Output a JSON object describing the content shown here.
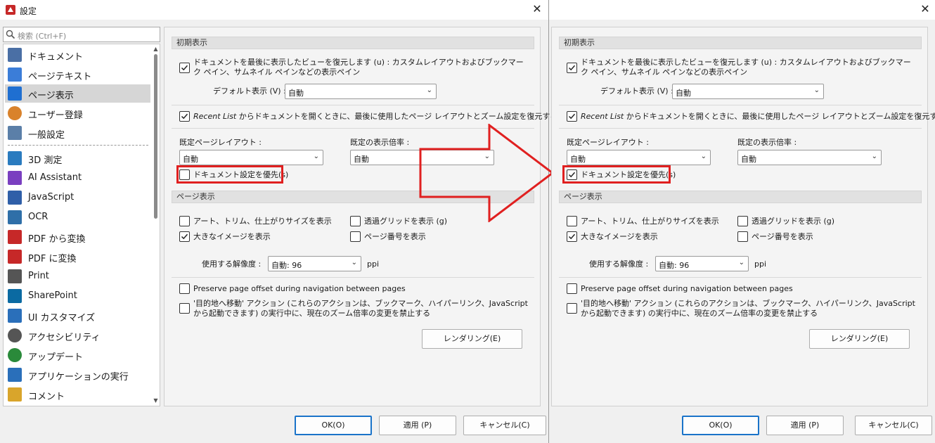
{
  "window": {
    "title": "設定",
    "close_label": "✕"
  },
  "search": {
    "placeholder": "検索 (Ctrl+F)"
  },
  "nav": {
    "items": [
      {
        "label": "ドキュメント",
        "icon": "document-icon",
        "color": "#4a6fa5"
      },
      {
        "label": "ページテキスト",
        "icon": "text-icon",
        "color": "#3b7dd8"
      },
      {
        "label": "ページ表示",
        "icon": "page-view-icon",
        "color": "#1f6fd1"
      },
      {
        "label": "ユーザー登録",
        "icon": "user-icon",
        "color": "#d9822b"
      },
      {
        "label": "一般設定",
        "icon": "general-settings-icon",
        "color": "#5b7fa8"
      },
      {
        "label": "3D 測定",
        "icon": "3d-measure-icon",
        "color": "#2a7bbf"
      },
      {
        "label": "AI Assistant",
        "icon": "ai-assistant-icon",
        "color": "#7a3fc0"
      },
      {
        "label": "JavaScript",
        "icon": "javascript-icon",
        "color": "#2f5fa8"
      },
      {
        "label": "OCR",
        "icon": "ocr-icon",
        "color": "#2f6fa8"
      },
      {
        "label": "PDF から変換",
        "icon": "pdf-from-icon",
        "color": "#c62828"
      },
      {
        "label": "PDF に変換",
        "icon": "pdf-to-icon",
        "color": "#c62828"
      },
      {
        "label": "Print",
        "icon": "printer-icon",
        "color": "#555555"
      },
      {
        "label": "SharePoint",
        "icon": "sharepoint-icon",
        "color": "#0b6aa2"
      },
      {
        "label": "UI カスタマイズ",
        "icon": "ui-customize-icon",
        "color": "#2a6fba"
      },
      {
        "label": "アクセシビリティ",
        "icon": "accessibility-icon",
        "color": "#555555"
      },
      {
        "label": "アップデート",
        "icon": "update-icon",
        "color": "#2a8a3a"
      },
      {
        "label": "アプリケーションの実行",
        "icon": "run-app-icon",
        "color": "#2a6fba"
      },
      {
        "label": "コメント",
        "icon": "comment-icon",
        "color": "#d9a52b"
      }
    ]
  },
  "settings": {
    "initial_group": "初期表示",
    "restore_view_label": "ドキュメントを最後に表示したビューを復元します (u) : カスタムレイアウトおよびブックマーク ペイン、サムネイル ペインなどの表示ペイン",
    "default_view_label": "デフォルト表示 (V) :",
    "default_view_value": "自動",
    "recent_list_em": "Recent List",
    "recent_list_rest": " からドキュメントを開くときに、最後に使用したページ レイアウトとズーム設定を復元する(t)",
    "page_layout_label": "既定ページレイアウト :",
    "page_layout_value": "自動",
    "zoom_label": "既定の表示倍率 :",
    "zoom_value": "自動",
    "prefer_doc_label": "ドキュメント設定を優先(s)",
    "page_group": "ページ表示",
    "art_trim_label": "アート、トリム、仕上がりサイズを表示",
    "transparency_grid_label": "透過グリッドを表示 (g)",
    "large_images_label": "大きなイメージを表示",
    "page_numbers_label": "ページ番号を表示",
    "resolution_label": "使用する解像度 :",
    "resolution_value": "自動: 96",
    "ppi_label": "ppi",
    "preserve_offset_label": "Preserve page offset during navigation between pages",
    "goto_action_label": "'目的地へ移動' アクション (これらのアクションは、ブックマーク、ハイパーリンク、JavaScriptから起動できます) の実行中に、現在のズーム倍率の変更を禁止する",
    "rendering_button": "レンダリング(E)"
  },
  "footer": {
    "ok": "OK(O)",
    "apply": "適用 (P)",
    "cancel": "キャンセル(C)"
  },
  "annotation": {
    "highlight_color": "#e02020"
  }
}
